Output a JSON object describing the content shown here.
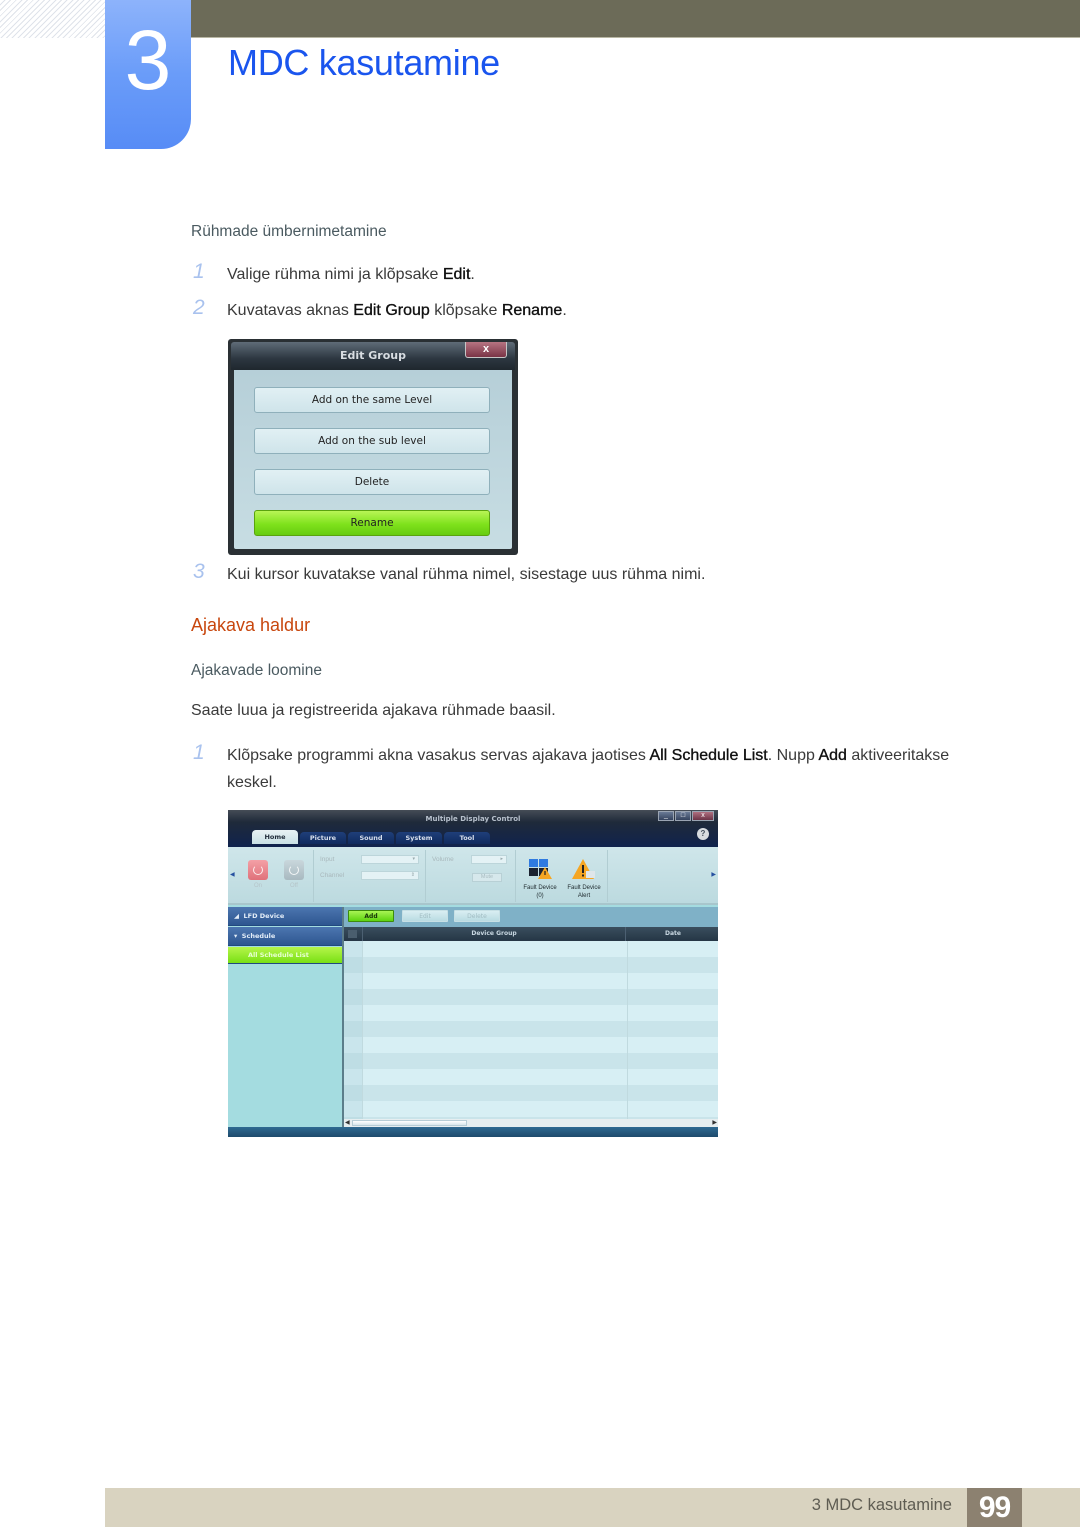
{
  "header": {
    "chapter_number": "3",
    "chapter_title": "MDC kasutamine"
  },
  "rename_section": {
    "heading": "Rühmade ümbernimetamine",
    "steps": [
      {
        "num": "1",
        "parts": [
          "Valige rühma nimi ja klõpsake ",
          "Edit",
          "."
        ]
      },
      {
        "num": "2",
        "parts": [
          "Kuvatavas aknas ",
          "Edit Group",
          " klõpsake ",
          "Rename",
          "."
        ]
      },
      {
        "num": "3",
        "text": "Kui kursor kuvatakse vanal rühma nimel, sisestage uus rühma nimi."
      }
    ]
  },
  "edit_group_dialog": {
    "title": "Edit Group",
    "close_icon": "close-icon",
    "close_label": "x",
    "buttons": [
      "Add on the same Level",
      "Add on the sub level",
      "Delete",
      "Rename"
    ],
    "highlighted_button": "Rename"
  },
  "schedule_section": {
    "heading": "Ajakava haldur",
    "subheading": "Ajakavade loomine",
    "intro": "Saate luua ja registreerida ajakava rühmade baasil.",
    "steps": [
      {
        "num": "1",
        "parts": [
          "Klõpsake programmi akna vasakus servas ajakava jaotises ",
          "All Schedule List",
          ". Nupp ",
          "Add",
          " aktiveeritakse keskel."
        ]
      }
    ]
  },
  "mdc_window": {
    "title": "Multiple Display Control",
    "window_buttons": [
      "_",
      "□",
      "x"
    ],
    "help_label": "?",
    "tabs": [
      "Home",
      "Picture",
      "Sound",
      "System",
      "Tool"
    ],
    "active_tab": "Home",
    "ribbon": {
      "power_on_label": "On",
      "power_off_label": "Off",
      "input_label": "Input",
      "channel_label": "Channel",
      "volume_label": "Volume",
      "mute_label": "Mute",
      "fault_device_label": "Fault Device",
      "fault_device_count": "(0)",
      "fault_alert_label": "Fault Device",
      "fault_alert_sub": "Alert"
    },
    "sidebar": {
      "items": [
        "LFD Device",
        "Schedule",
        "All Schedule List"
      ],
      "selected": "All Schedule List"
    },
    "toolbar": {
      "add_label": "Add",
      "edit_label": "Edit",
      "delete_label": "Delete"
    },
    "grid": {
      "columns": [
        "Device Group",
        "Date"
      ],
      "rows": []
    },
    "colors": {
      "accent_green": "#7fe21c",
      "title_navy": "#0e2250",
      "panel_cyan": "#a4dce0"
    }
  },
  "footer": {
    "label": "3 MDC kasutamine",
    "page_number": "99"
  },
  "colors": {
    "title_blue": "#1a55ee",
    "section_orange": "#c8470e",
    "header_bar": "#6c6b58",
    "footer_bar": "#d9d3c0",
    "page_box": "#8c8170"
  }
}
